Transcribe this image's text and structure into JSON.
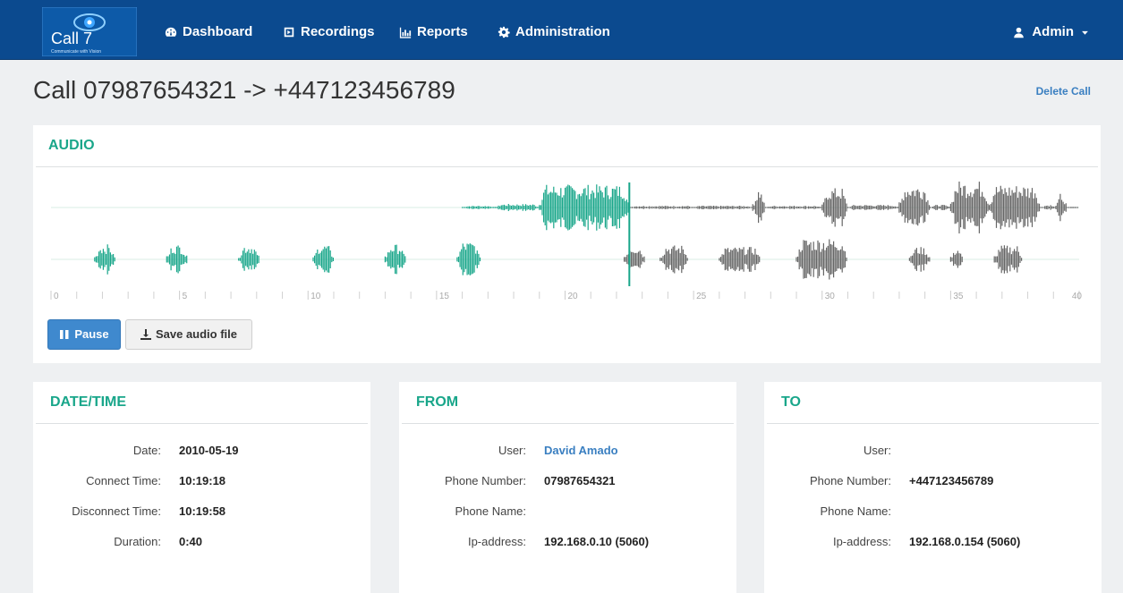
{
  "navbar": {
    "logo_text": "Call 7",
    "logo_tagline": "Communicate with Vision",
    "items": [
      {
        "label": "Dashboard",
        "icon": "dashboard-icon"
      },
      {
        "label": "Recordings",
        "icon": "play-square-icon"
      },
      {
        "label": "Reports",
        "icon": "bar-chart-icon"
      },
      {
        "label": "Administration",
        "icon": "gear-icon"
      }
    ],
    "user": {
      "label": "Admin",
      "icon": "user-icon",
      "caret": "caret-down-icon"
    }
  },
  "page": {
    "title": "Call 07987654321 -> +447123456789",
    "delete_label": "Delete Call"
  },
  "audio": {
    "heading": "AUDIO",
    "timeline_ticks": [
      "0",
      "5",
      "10",
      "15",
      "20",
      "25",
      "30",
      "35",
      "40"
    ],
    "playhead_seconds": 22.5,
    "duration_seconds": 40,
    "pause_label": "Pause",
    "save_label": "Save audio file",
    "colors": {
      "played": "#19a68a",
      "unplayed": "#666666",
      "accent": "#3f89ce"
    }
  },
  "datetime": {
    "heading": "DATE/TIME",
    "rows": [
      {
        "label": "Date:",
        "value": "2010-05-19"
      },
      {
        "label": "Connect Time:",
        "value": "10:19:18"
      },
      {
        "label": "Disconnect Time:",
        "value": "10:19:58"
      },
      {
        "label": "Duration:",
        "value": "0:40"
      }
    ]
  },
  "from": {
    "heading": "FROM",
    "rows": [
      {
        "label": "User:",
        "value": "David Amado"
      },
      {
        "label": "Phone Number:",
        "value": "07987654321"
      },
      {
        "label": "Phone Name:",
        "value": ""
      },
      {
        "label": "Ip-address:",
        "value": "192.168.0.10 (5060)"
      }
    ]
  },
  "to": {
    "heading": "TO",
    "rows": [
      {
        "label": "User:",
        "value": ""
      },
      {
        "label": "Phone Number:",
        "value": "+447123456789"
      },
      {
        "label": "Phone Name:",
        "value": ""
      },
      {
        "label": "Ip-address:",
        "value": "192.168.0.154 (5060)"
      }
    ]
  }
}
